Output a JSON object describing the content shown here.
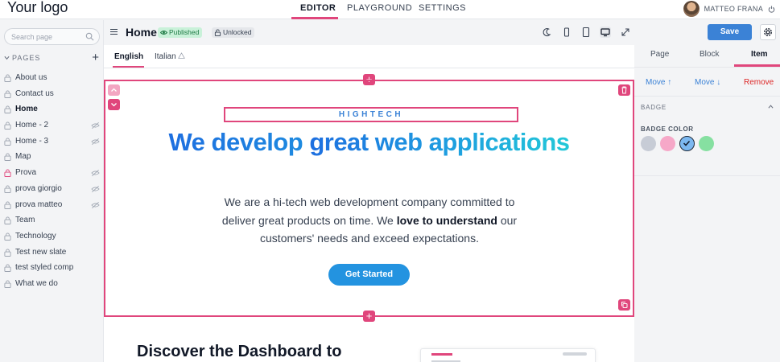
{
  "topnav": {
    "logo": "Your logo",
    "tabs": [
      "EDITOR",
      "PLAYGROUND",
      "SETTINGS"
    ],
    "active_tab": "EDITOR",
    "user_name": "MATTEO FRANA"
  },
  "sidebar": {
    "search_placeholder": "Search page",
    "pages_heading": "PAGES",
    "add_symbol": "+",
    "items": [
      {
        "label": "About us",
        "active": false,
        "hidden": false,
        "protected": false
      },
      {
        "label": "Contact us",
        "active": false,
        "hidden": false,
        "protected": false
      },
      {
        "label": "Home",
        "active": true,
        "hidden": false,
        "protected": false
      },
      {
        "label": "Home - 2",
        "active": false,
        "hidden": true,
        "protected": false
      },
      {
        "label": "Home - 3",
        "active": false,
        "hidden": true,
        "protected": false
      },
      {
        "label": "Map",
        "active": false,
        "hidden": false,
        "protected": false
      },
      {
        "label": "Prova",
        "active": false,
        "hidden": true,
        "protected": true
      },
      {
        "label": "prova giorgio",
        "active": false,
        "hidden": true,
        "protected": false
      },
      {
        "label": "prova matteo",
        "active": false,
        "hidden": true,
        "protected": false
      },
      {
        "label": "Team",
        "active": false,
        "hidden": false,
        "protected": false
      },
      {
        "label": "Technology",
        "active": false,
        "hidden": false,
        "protected": false
      },
      {
        "label": "Test new slate",
        "active": false,
        "hidden": false,
        "protected": false
      },
      {
        "label": "test styled comp",
        "active": false,
        "hidden": false,
        "protected": false
      },
      {
        "label": "What we do",
        "active": false,
        "hidden": false,
        "protected": false
      }
    ]
  },
  "toolbar": {
    "page_title": "Home",
    "published_label": "Published",
    "unlocked_label": "Unlocked",
    "save_label": "Save"
  },
  "canvas": {
    "languages": [
      "English",
      "Italian"
    ],
    "active_language": "English",
    "add_symbol": "+",
    "hero": {
      "badge": "HIGHTECH",
      "headline_dark": "We develop",
      "headline_grad": "great web applications",
      "text_before": "We are a hi-tech web development company committed to deliver great products on time. We ",
      "text_bold": "love to understand",
      "text_after": " our customers' needs and exceed expectations.",
      "cta_label": "Get Started"
    },
    "next_section_title": "Discover the Dashboard to"
  },
  "right_panel": {
    "tabs": [
      "Page",
      "Block",
      "Item"
    ],
    "active_tab": "Item",
    "move_up_label": "Move ↑",
    "move_down_label": "Move ↓",
    "remove_label": "Remove",
    "badge_section": "BADGE",
    "badge_color_label": "BADGE COLOR",
    "badge_colors": [
      {
        "name": "gray",
        "hex": "#c7ccd6",
        "selected": false
      },
      {
        "name": "pink",
        "hex": "#f6a8c8",
        "selected": false
      },
      {
        "name": "blue",
        "hex": "#7cb8f0",
        "selected": true
      },
      {
        "name": "green",
        "hex": "#86e0a1",
        "selected": false
      }
    ]
  },
  "colors": {
    "accent": "#e0467c",
    "primary": "#3b82d6",
    "cta": "#2393e0"
  }
}
